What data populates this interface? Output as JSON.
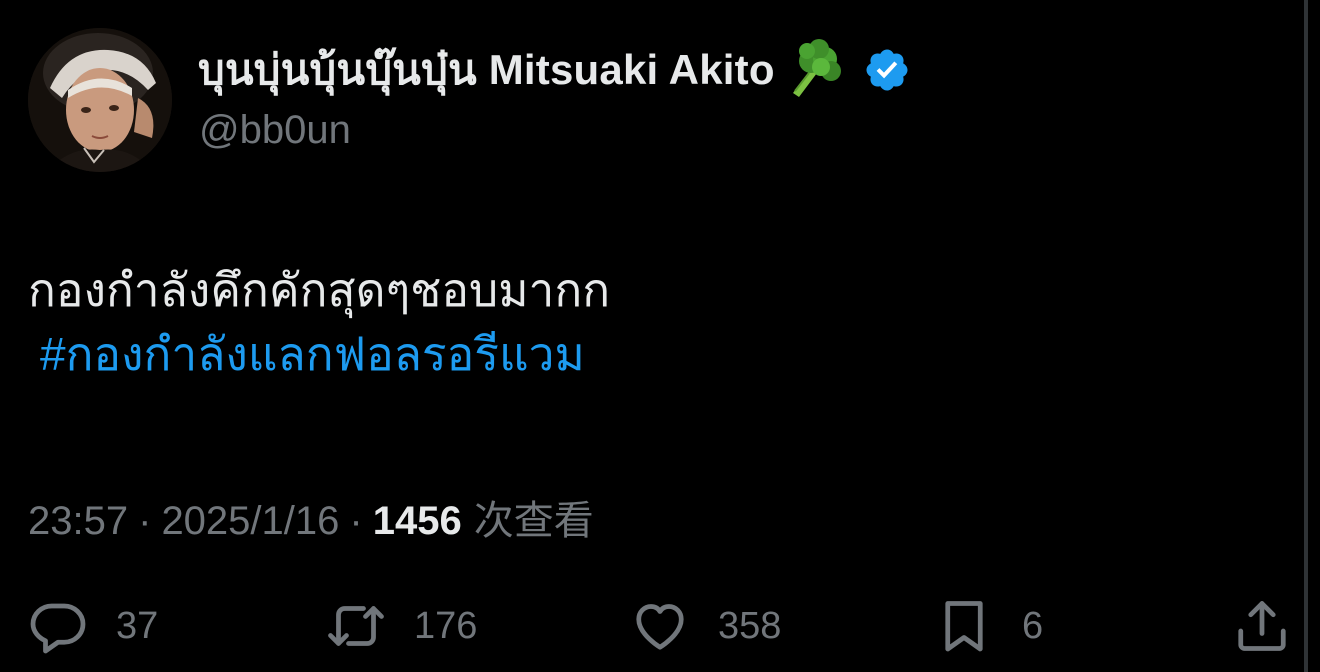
{
  "author": {
    "display_name": "บุนบุ่นบุ้นบุ๊นบุ๋น Mitsuaki Akito",
    "emoji": "broccoli-icon",
    "verified_icon": "verified-badge-icon",
    "handle": "@bb0un"
  },
  "tweet": {
    "text": "กองกำลังคึกคักสุดๆชอบมากก",
    "hashtag": "#กองกำลังแลกฟอลรอรีแวม"
  },
  "meta": {
    "time": "23:57",
    "separator": "·",
    "date": "2025/1/16",
    "views_count": "1456",
    "views_label": "次查看"
  },
  "actions": {
    "reply": {
      "icon": "reply-icon",
      "count": "37"
    },
    "retweet": {
      "icon": "retweet-icon",
      "count": "176"
    },
    "like": {
      "icon": "heart-icon",
      "count": "358"
    },
    "bookmark": {
      "icon": "bookmark-icon",
      "count": "6"
    },
    "share": {
      "icon": "share-icon"
    }
  },
  "colors": {
    "background": "#000000",
    "text": "#e7e9ea",
    "muted": "#71767b",
    "accent": "#1d9bf0"
  }
}
